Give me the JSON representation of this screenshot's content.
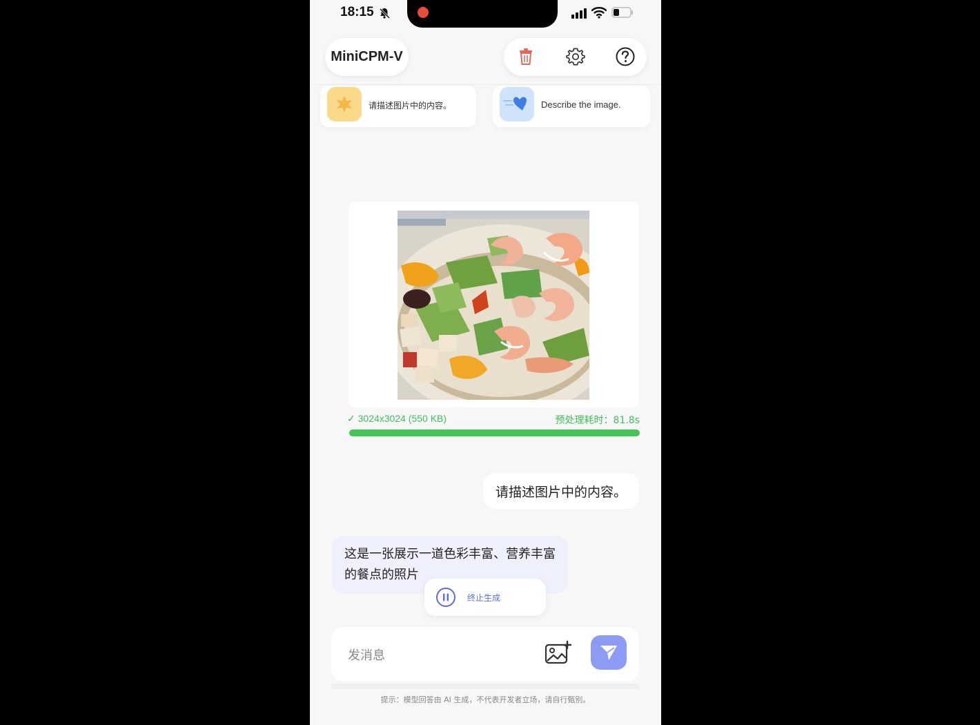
{
  "status_bar": {
    "time": "18:15"
  },
  "header": {
    "title": "MiniCPM-V",
    "actions": [
      "trash-icon",
      "gear-icon",
      "help-icon"
    ],
    "accent_colors": {
      "trash": "#e06b5b",
      "icon": "#333333"
    }
  },
  "prompt_suggestions": [
    {
      "label": "请描述图片中的内容。",
      "icon": "star-badge-icon"
    },
    {
      "label": "Describe the image.",
      "icon": "heart-speed-icon"
    }
  ],
  "image_card": {
    "meta": "3024x3024 (550 KB)",
    "preprocess_time": "预处理耗时：81.8s",
    "progress": 1.0,
    "accent_color": "#43c559"
  },
  "messages": [
    {
      "role": "user",
      "text": "请描述图片中的内容。"
    },
    {
      "role": "assistant",
      "text": "这是一张展示一道色彩丰富、营养丰富的餐点的照片"
    }
  ],
  "stop_generation": {
    "label": "终止生成"
  },
  "composer": {
    "placeholder": "发消息",
    "send_color": "#8d9bf5"
  },
  "disclaimer": "提示：模型回答由 AI 生成，不代表开发者立场，请自行甄别。"
}
